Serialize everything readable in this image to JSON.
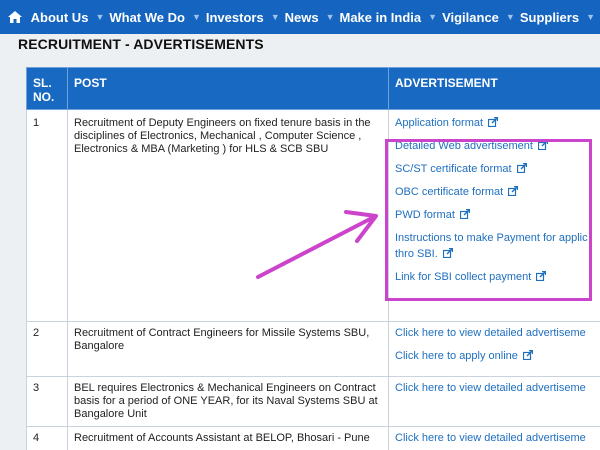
{
  "nav": {
    "items": [
      "About Us",
      "What We Do",
      "Investors",
      "News",
      "Make in India",
      "Vigilance",
      "Suppliers"
    ]
  },
  "page": {
    "title": "RECRUITMENT - ADVERTISEMENTS"
  },
  "table": {
    "headers": {
      "sl": "SL. NO.",
      "post": "POST",
      "advertisement": "ADVERTISEMENT"
    },
    "rows": [
      {
        "sl": "1",
        "post": "Recruitment of Deputy Engineers on fixed tenure basis in the disciplines of Electronics, Mechanical , Computer Science , Electronics & MBA (Marketing ) for HLS & SCB SBU",
        "links": [
          "Application format",
          "Detailed Web advertisement",
          "SC/ST certificate format",
          "OBC certificate format",
          "PWD format",
          "Instructions to make Payment for applic",
          "thro SBI.",
          "Link for SBI collect payment"
        ]
      },
      {
        "sl": "2",
        "post": "Recruitment of Contract Engineers for Missile Systems SBU, Bangalore",
        "links": [
          "Click here to view detailed advertiseme",
          "Click here to apply online"
        ]
      },
      {
        "sl": "3",
        "post": "BEL requires Electronics & Mechanical Engineers on Contract basis for a period of ONE YEAR, for its Naval Systems SBU at Bangalore Unit",
        "links": [
          "Click here to view detailed advertiseme"
        ]
      },
      {
        "sl": "4",
        "post": "Recruitment of Accounts Assistant at BELOP, Bhosari - Pune",
        "links": [
          "Click here to view detailed advertiseme"
        ]
      }
    ]
  },
  "colors": {
    "nav": "#1565c0",
    "header": "#1769c2",
    "link": "#1f6fbf",
    "highlight": "#cc44cc"
  },
  "icons": {
    "home": "home-icon",
    "external": "external-link-icon"
  }
}
